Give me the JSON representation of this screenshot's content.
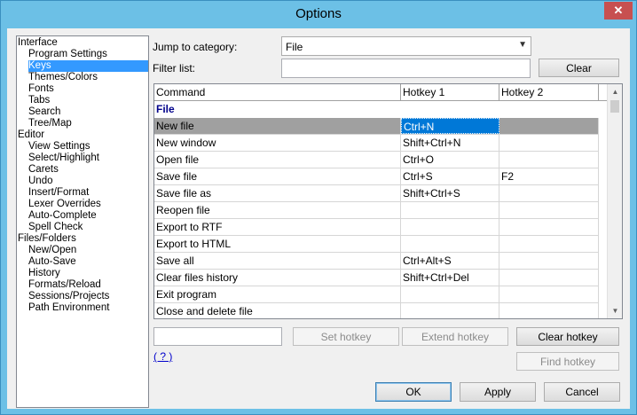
{
  "window": {
    "title": "Options"
  },
  "tree": [
    {
      "label": "Interface",
      "level": 0,
      "selected": false
    },
    {
      "label": "Program Settings",
      "level": 1,
      "selected": false
    },
    {
      "label": "Keys",
      "level": 1,
      "selected": true
    },
    {
      "label": "Themes/Colors",
      "level": 1,
      "selected": false
    },
    {
      "label": "Fonts",
      "level": 1,
      "selected": false
    },
    {
      "label": "Tabs",
      "level": 1,
      "selected": false
    },
    {
      "label": "Search",
      "level": 1,
      "selected": false
    },
    {
      "label": "Tree/Map",
      "level": 1,
      "selected": false
    },
    {
      "label": "Editor",
      "level": 0,
      "selected": false
    },
    {
      "label": "View Settings",
      "level": 1,
      "selected": false
    },
    {
      "label": "Select/Highlight",
      "level": 1,
      "selected": false
    },
    {
      "label": "Carets",
      "level": 1,
      "selected": false
    },
    {
      "label": "Undo",
      "level": 1,
      "selected": false
    },
    {
      "label": "Insert/Format",
      "level": 1,
      "selected": false
    },
    {
      "label": "Lexer Overrides",
      "level": 1,
      "selected": false
    },
    {
      "label": "Auto-Complete",
      "level": 1,
      "selected": false
    },
    {
      "label": "Spell Check",
      "level": 1,
      "selected": false
    },
    {
      "label": "Files/Folders",
      "level": 0,
      "selected": false
    },
    {
      "label": "New/Open",
      "level": 1,
      "selected": false
    },
    {
      "label": "Auto-Save",
      "level": 1,
      "selected": false
    },
    {
      "label": "History",
      "level": 1,
      "selected": false
    },
    {
      "label": "Formats/Reload",
      "level": 1,
      "selected": false
    },
    {
      "label": "Sessions/Projects",
      "level": 1,
      "selected": false
    },
    {
      "label": "Path Environment",
      "level": 1,
      "selected": false
    }
  ],
  "jump": {
    "label": "Jump to category:",
    "value": "File"
  },
  "filter": {
    "label": "Filter list:",
    "value": "",
    "clear_label": "Clear"
  },
  "grid": {
    "columns": [
      "Command",
      "Hotkey 1",
      "Hotkey 2"
    ],
    "group": "File",
    "rows": [
      {
        "command": "New file",
        "hotkey1": "Ctrl+N",
        "hotkey2": "",
        "selected": true
      },
      {
        "command": "New window",
        "hotkey1": "Shift+Ctrl+N",
        "hotkey2": ""
      },
      {
        "command": "Open file",
        "hotkey1": "Ctrl+O",
        "hotkey2": ""
      },
      {
        "command": "Save file",
        "hotkey1": "Ctrl+S",
        "hotkey2": "F2"
      },
      {
        "command": "Save file as",
        "hotkey1": "Shift+Ctrl+S",
        "hotkey2": ""
      },
      {
        "command": "Reopen file",
        "hotkey1": "",
        "hotkey2": ""
      },
      {
        "command": "Export to RTF",
        "hotkey1": "",
        "hotkey2": ""
      },
      {
        "command": "Export to HTML",
        "hotkey1": "",
        "hotkey2": ""
      },
      {
        "command": "Save all",
        "hotkey1": "Ctrl+Alt+S",
        "hotkey2": ""
      },
      {
        "command": "Clear files history",
        "hotkey1": "Shift+Ctrl+Del",
        "hotkey2": ""
      },
      {
        "command": "Exit program",
        "hotkey1": "",
        "hotkey2": ""
      },
      {
        "command": "Close and delete file",
        "hotkey1": "",
        "hotkey2": ""
      }
    ]
  },
  "hotkey": {
    "input_value": "",
    "set_label": "Set hotkey",
    "extend_label": "Extend hotkey",
    "clear_label": "Clear hotkey",
    "find_label": "Find hotkey",
    "help_label": "( ? )"
  },
  "footer": {
    "ok_label": "OK",
    "apply_label": "Apply",
    "cancel_label": "Cancel"
  },
  "colors": {
    "titlebar": "#6cc0e6",
    "selection": "#3399ff",
    "close": "#c75050"
  }
}
